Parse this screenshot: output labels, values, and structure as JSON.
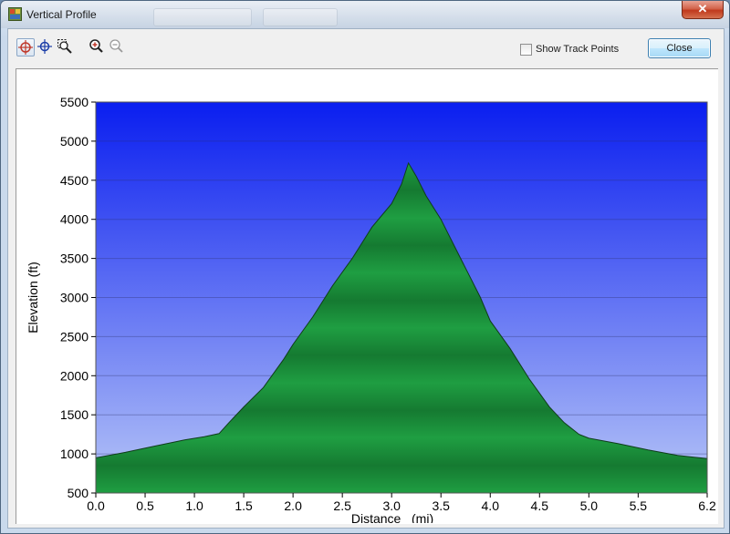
{
  "window": {
    "title": "Vertical Profile",
    "close_glyph": "✕"
  },
  "toolbar": {
    "tools": [
      {
        "name": "select-tool",
        "icon": "crosshair-select-icon",
        "active": true
      },
      {
        "name": "pan-tool",
        "icon": "crosshair-icon",
        "active": false
      },
      {
        "name": "zoom-region-tool",
        "icon": "zoom-region-icon",
        "active": false
      },
      {
        "name": "zoom-in-tool",
        "icon": "zoom-in-icon",
        "active": false
      },
      {
        "name": "zoom-out-tool",
        "icon": "zoom-out-icon",
        "active": false
      }
    ],
    "show_track_points_label": "Show Track Points",
    "show_track_points_checked": false,
    "close_label": "Close"
  },
  "colors": {
    "sky_top": "#0a1ef0",
    "sky_bottom": "#b7c6f7",
    "terrain": "#1a9a3c",
    "terrain_outline": "#0f3d1a"
  },
  "chart_data": {
    "type": "area",
    "title": "",
    "xlabel": "Distance   (mi)",
    "ylabel": "Elevation (ft)",
    "xlim": [
      0,
      6.2
    ],
    "ylim": [
      500,
      5500
    ],
    "x_ticks": [
      "0.0",
      "0.5",
      "1.0",
      "1.5",
      "2.0",
      "2.5",
      "3.0",
      "3.5",
      "4.0",
      "4.5",
      "5.0",
      "5.5",
      "6.2"
    ],
    "y_ticks": [
      "500",
      "1000",
      "1500",
      "2000",
      "2500",
      "3000",
      "3500",
      "4000",
      "4500",
      "5000",
      "5500"
    ],
    "grid": true,
    "x": [
      0.0,
      0.3,
      0.6,
      0.9,
      1.1,
      1.25,
      1.35,
      1.5,
      1.7,
      1.9,
      2.0,
      2.2,
      2.4,
      2.6,
      2.8,
      3.0,
      3.1,
      3.17,
      3.25,
      3.35,
      3.5,
      3.7,
      3.9,
      4.0,
      4.2,
      4.4,
      4.6,
      4.75,
      4.9,
      5.0,
      5.3,
      5.6,
      5.9,
      6.2
    ],
    "y": [
      950,
      1020,
      1100,
      1180,
      1220,
      1260,
      1400,
      1600,
      1850,
      2200,
      2400,
      2750,
      3150,
      3500,
      3900,
      4200,
      4450,
      4720,
      4550,
      4300,
      4000,
      3500,
      3000,
      2700,
      2350,
      1950,
      1600,
      1400,
      1250,
      1200,
      1130,
      1050,
      980,
      940
    ]
  }
}
